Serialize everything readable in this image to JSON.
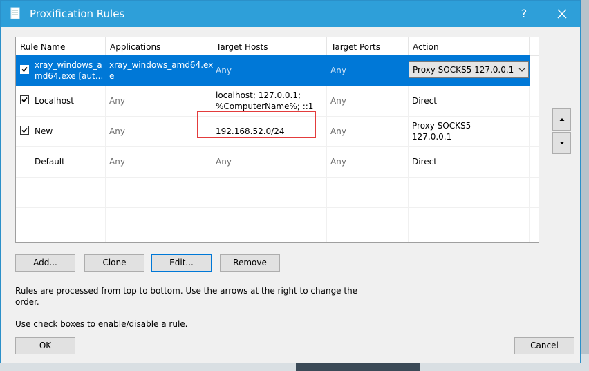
{
  "dialog": {
    "title": "Proxification Rules",
    "help_label": "?"
  },
  "table": {
    "columns": [
      "Rule Name",
      "Applications",
      "Target Hosts",
      "Target Ports",
      "Action"
    ],
    "rows": [
      {
        "checked": true,
        "name": "xray_windows_a\nmd64.exe [aut...",
        "applications": "xray_windows_amd64.ex\ne",
        "hosts": "Any",
        "ports": "Any",
        "action": "Proxy SOCKS5 127.0.0.1",
        "selected": true
      },
      {
        "checked": true,
        "name": "Localhost",
        "applications": "Any",
        "hosts": "localhost; 127.0.0.1;\n%ComputerName%; ::1",
        "ports": "Any",
        "action": "Direct",
        "selected": false
      },
      {
        "checked": true,
        "name": "New",
        "applications": "Any",
        "hosts": "192.168.52.0/24",
        "ports": "Any",
        "action": "Proxy SOCKS5\n127.0.0.1",
        "selected": false
      },
      {
        "checked": false,
        "name": "Default",
        "applications": "Any",
        "hosts": "Any",
        "ports": "Any",
        "action": "Direct",
        "selected": false
      }
    ]
  },
  "buttons": {
    "add": "Add...",
    "clone": "Clone",
    "edit": "Edit...",
    "remove": "Remove",
    "ok": "OK",
    "cancel": "Cancel"
  },
  "notes": {
    "order": "Rules are processed from top to bottom. Use the arrows at the right to change the\norder.",
    "checkboxes": "Use check boxes to enable/disable a rule."
  },
  "colors": {
    "titlebar": "#2e9fd9",
    "selection": "#0078d7",
    "highlight_box": "#e33c3c"
  }
}
